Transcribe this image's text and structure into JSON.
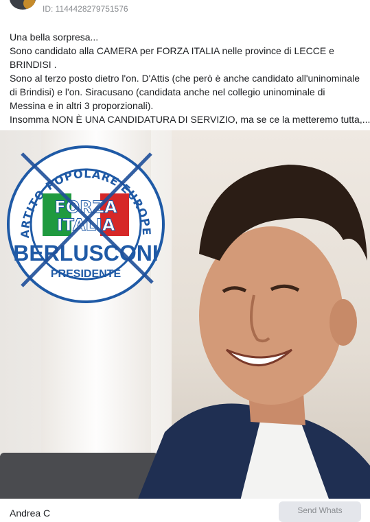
{
  "post": {
    "id_text": "ID: 1144428279751576",
    "text_lines": [
      "Una bella sorpresa...",
      "Sono candidato alla CAMERA per FORZA ITALIA nelle province di LECCE e",
      "BRINDISI .",
      "Sono al terzo posto dietro l'on. D'Attis (che però è anche candidato all'uninominale",
      "di Brindisi) e l'on. Siracusano (candidata anche nel collegio uninominale di",
      "Messina e in altri 3 proporzionali).",
      "Insomma NON È UNA CANDIDATURA DI SERVIZIO, ma se ce la metteremo tutta,..."
    ]
  },
  "logo": {
    "ring_text": "PARTITO POPOLARE EUROPEO",
    "flag_text_1": "FORZA",
    "flag_text_2": "ITALIA",
    "brand": "BERLUSCONI",
    "subtitle": "PRESIDENTE",
    "colors": {
      "blue": "#1f5aa6",
      "green": "#1f9a3f",
      "red": "#d62828",
      "cross": "#1f4f9a"
    }
  },
  "footer": {
    "name": "Andrea C",
    "send_button": "Send Whats"
  }
}
